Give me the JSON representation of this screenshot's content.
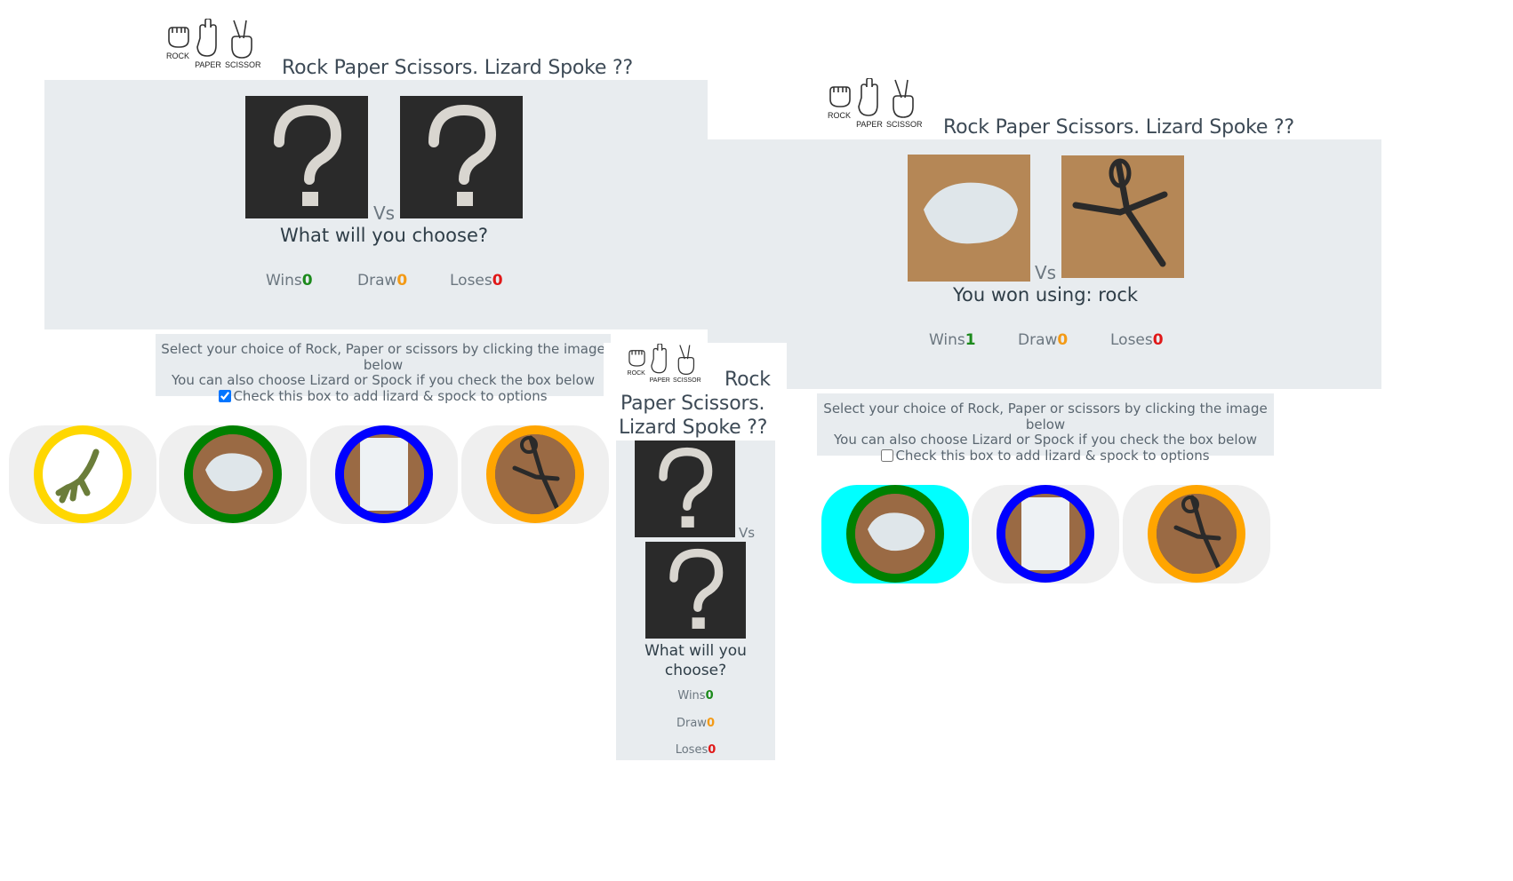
{
  "title": "Rock Paper Scissors. Lizard Spoke ??",
  "logo": {
    "rock": "ROCK",
    "paper": "PAPER",
    "scissor": "SCISSOR"
  },
  "vs": "Vs",
  "colors": {
    "wins": "#1c8a1c",
    "draw": "#f39a16",
    "loses": "#e01818",
    "lizard": "#ffd700",
    "rock": "#008000",
    "paper": "#0000ff",
    "scissors": "#ffa500",
    "active": "#00ffff"
  },
  "screen1": {
    "message": "What will you choose?",
    "wins_label": "Wins",
    "wins": "0",
    "draw_label": "Draw",
    "draw": "0",
    "loses_label": "Loses",
    "loses": "0",
    "instructions": {
      "line1": "Select your choice of Rock, Paper or scissors by clicking the image below",
      "line2": "You can also choose Lizard or Spock if you check the box below",
      "checkbox_label": "Check this box to add lizard & spock to options",
      "checked": true
    },
    "choices": [
      "lizard",
      "rock",
      "paper",
      "scissors"
    ]
  },
  "screen2": {
    "message": "You won using: rock",
    "wins_label": "Wins",
    "wins": "1",
    "draw_label": "Draw",
    "draw": "0",
    "loses_label": "Loses",
    "loses": "0",
    "instructions": {
      "line1": "Select your choice of Rock, Paper or scissors by clicking the image below",
      "line2": "You can also choose Lizard or Spock if you check the box below",
      "checkbox_label": "Check this box to add lizard & spock to options",
      "checked": false
    },
    "choices": [
      "rock",
      "paper",
      "scissors"
    ],
    "selected": "rock"
  },
  "screen3": {
    "title_line1": "Rock",
    "title_line2": "Paper Scissors.",
    "title_line3": "Lizard Spoke ??",
    "message_line1": "What will you",
    "message_line2": "choose?",
    "wins_label": "Wins",
    "wins": "0",
    "draw_label": "Draw",
    "draw": "0",
    "loses_label": "Loses",
    "loses": "0"
  }
}
